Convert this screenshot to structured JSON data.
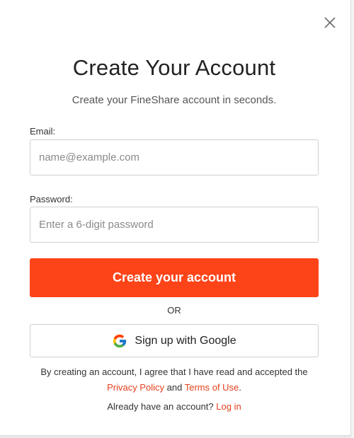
{
  "modal": {
    "title": "Create Your Account",
    "subtitle": "Create your FineShare account in seconds."
  },
  "form": {
    "email_label": "Email:",
    "email_placeholder": "name@example.com",
    "email_value": "",
    "password_label": "Password:",
    "password_placeholder": "Enter a 6-digit password",
    "password_value": "",
    "submit_label": "Create your account",
    "divider_label": "OR",
    "google_label": "Sign up with Google"
  },
  "terms": {
    "prefix": "By creating an account, I agree that I have read and accepted the",
    "privacy_label": "Privacy Policy",
    "and_text": "and",
    "terms_label": "Terms of Use",
    "suffix": "."
  },
  "login": {
    "prompt": "Already have an account?",
    "link_label": "Log in"
  },
  "icons": {
    "close": "close-icon",
    "google": "google-logo-icon"
  },
  "colors": {
    "accent": "#fd4419",
    "link": "#e4411c",
    "title": "#222222",
    "border": "#cfcfcf"
  }
}
